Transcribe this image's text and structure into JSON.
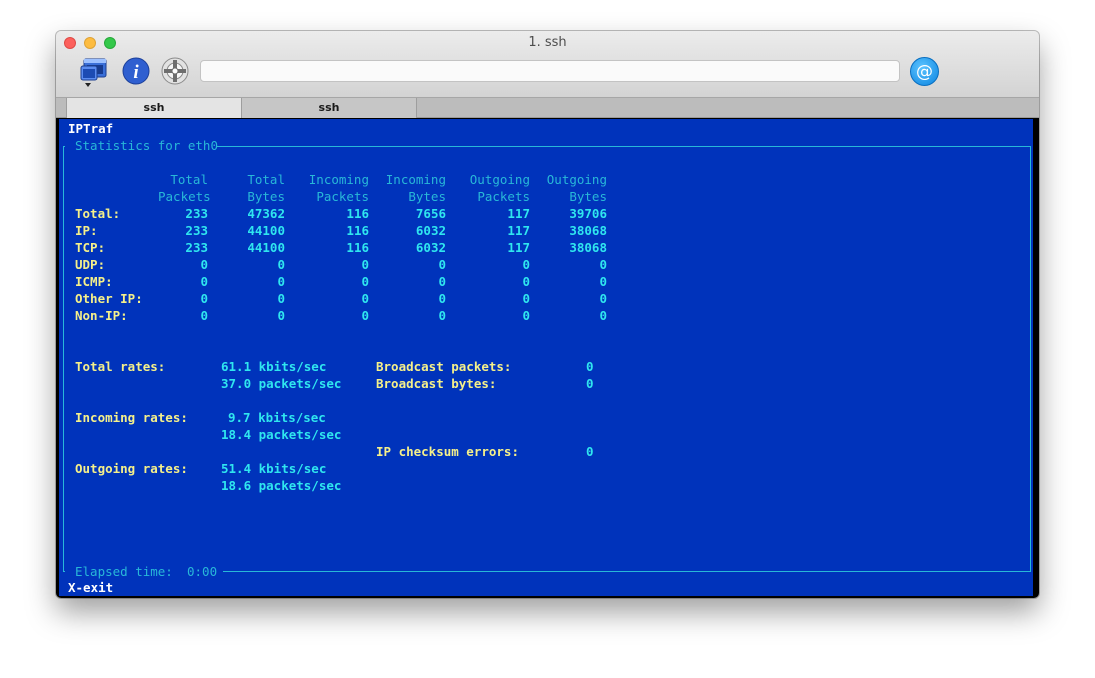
{
  "window": {
    "title": "1. ssh",
    "tabs": [
      {
        "label": "ssh",
        "active": true
      },
      {
        "label": "ssh",
        "active": false
      }
    ]
  },
  "colors": {
    "terminal_bg": "#0033bb",
    "heading": "#ffffff",
    "label": "#f5f08a",
    "value": "#2fe6ef",
    "border": "#28b8d8"
  },
  "terminal": {
    "app_title": "IPTraf",
    "panel_title": "Statistics for eth0",
    "columns": [
      [
        "Total",
        "Packets"
      ],
      [
        "Total",
        "Bytes"
      ],
      [
        "Incoming",
        "Packets"
      ],
      [
        "Incoming",
        "Bytes"
      ],
      [
        "Outgoing",
        "Packets"
      ],
      [
        "Outgoing",
        "Bytes"
      ]
    ],
    "rows": [
      {
        "label": "Total:",
        "values": [
          "233",
          "47362",
          "116",
          "7656",
          "117",
          "39706"
        ]
      },
      {
        "label": "IP:",
        "values": [
          "233",
          "44100",
          "116",
          "6032",
          "117",
          "38068"
        ]
      },
      {
        "label": "TCP:",
        "values": [
          "233",
          "44100",
          "116",
          "6032",
          "117",
          "38068"
        ]
      },
      {
        "label": "UDP:",
        "values": [
          "0",
          "0",
          "0",
          "0",
          "0",
          "0"
        ]
      },
      {
        "label": "ICMP:",
        "values": [
          "0",
          "0",
          "0",
          "0",
          "0",
          "0"
        ]
      },
      {
        "label": "Other IP:",
        "values": [
          "0",
          "0",
          "0",
          "0",
          "0",
          "0"
        ]
      },
      {
        "label": "Non-IP:",
        "values": [
          "0",
          "0",
          "0",
          "0",
          "0",
          "0"
        ]
      }
    ],
    "rates": {
      "total_label": "Total rates:",
      "total_kbits": "61.1 kbits/sec",
      "total_packets": "37.0 packets/sec",
      "incoming_label": "Incoming rates:",
      "incoming_kbits": "9.7 kbits/sec",
      "incoming_packets": "18.4 packets/sec",
      "outgoing_label": "Outgoing rates:",
      "outgoing_kbits": "51.4 kbits/sec",
      "outgoing_packets": "18.6 packets/sec"
    },
    "side": {
      "broadcast_packets_label": "Broadcast packets:",
      "broadcast_packets_value": "0",
      "broadcast_bytes_label": "Broadcast bytes:",
      "broadcast_bytes_value": "0",
      "checksum_label": "IP checksum errors:",
      "checksum_value": "0"
    },
    "elapsed_label": "Elapsed time:",
    "elapsed_value": "0:00",
    "exit_hint": "X-exit"
  }
}
